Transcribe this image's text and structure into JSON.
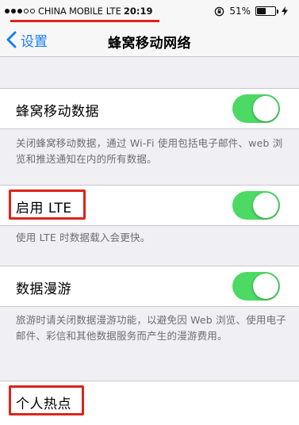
{
  "status_bar": {
    "carrier": "CHINA MOBILE",
    "network": "LTE",
    "time": "20:19",
    "battery_percent": "51%",
    "battery_level": 0.51
  },
  "nav": {
    "back_label": "设置",
    "title": "蜂窝移动网络"
  },
  "cells": [
    {
      "label": "蜂窝移动数据",
      "toggle_on": true,
      "footer": "关闭蜂窝移动数据，通过 Wi-Fi 使用包括电子邮件、web 浏览和推送通知在内的所有数据。"
    },
    {
      "label": "启用 LTE",
      "toggle_on": true,
      "footer": "使用 LTE 时数据载入会更快。"
    },
    {
      "label": "数据漫游",
      "toggle_on": true,
      "footer": "旅游时请关闭数据漫游功能，以避免因 Web 浏览、使用电子邮件、彩信和其他数据服务而产生的漫游费用。"
    },
    {
      "label": "个人热点"
    }
  ],
  "colors": {
    "accent": "#1a7cf5",
    "toggle_on": "#4cd964",
    "highlight": "#d9251c"
  }
}
